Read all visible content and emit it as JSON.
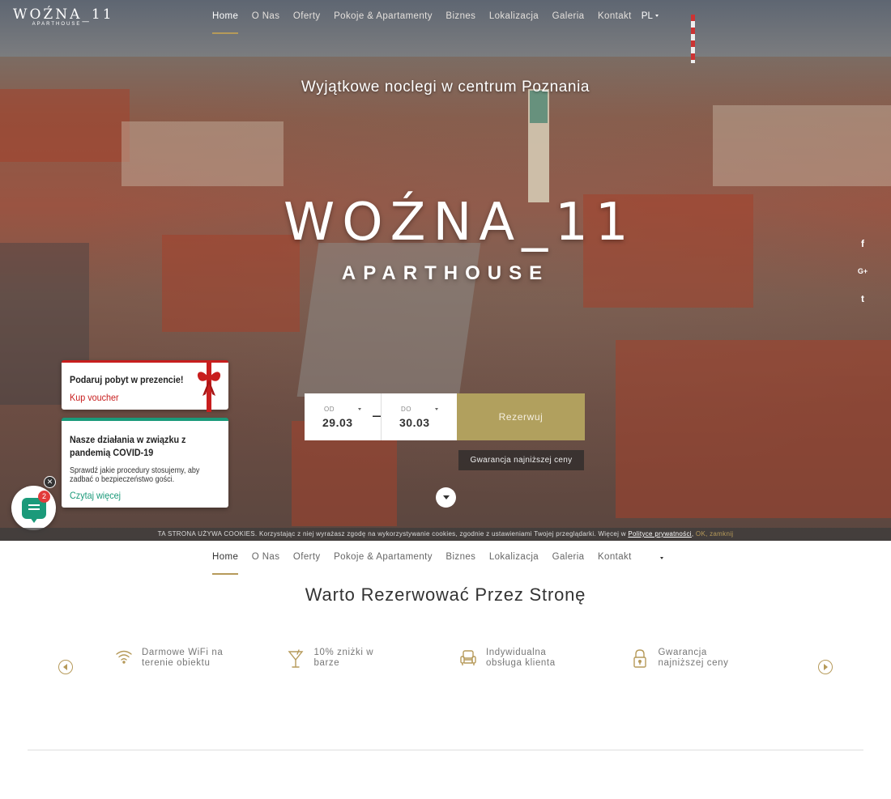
{
  "brand": {
    "name": "WOŹNA_11",
    "sub": "APARTHOUSE"
  },
  "nav": {
    "items": [
      "Home",
      "O Nas",
      "Oferty",
      "Pokoje & Apartamenty",
      "Biznes",
      "Lokalizacja",
      "Galeria",
      "Kontakt"
    ],
    "active": "Home",
    "lang": "PL"
  },
  "hero": {
    "tagline": "Wyjątkowe noclegi w centrum Poznania",
    "logo_word": "WOŹNA_11",
    "logo_sub": "APARTHOUSE"
  },
  "social": [
    "facebook-icon",
    "google-plus-icon",
    "twitter-icon"
  ],
  "social_glyphs": [
    "f",
    "G+",
    "t"
  ],
  "booking": {
    "from_label": "OD",
    "from_value": "29.03",
    "to_label": "DO",
    "to_value": "30.03",
    "reserve_label": "Rezerwuj",
    "guarantee": "Gwarancja najniższej ceny"
  },
  "voucher_popup": {
    "title": "Podaruj pobyt w prezencie!",
    "link": "Kup voucher"
  },
  "covid_popup": {
    "title": "Nasze działania w związku z pandemią COVID-19",
    "desc": "Sprawdź jakie procedury stosujemy, aby zadbać o bezpieczeństwo gości.",
    "link": "Czytaj więcej"
  },
  "chat": {
    "badge": "2"
  },
  "cookie": {
    "text": "TA STRONA UŻYWA COOKIES. Korzystając z niej wyrażasz zgodę na wykorzystywanie cookies, zgodnie z ustawieniami Twojej przeglądarki. Więcej w",
    "policy": "Polityce prywatności",
    "ok": "OK, zamknij"
  },
  "section": {
    "title": "Warto Rezerwować Przez Stronę",
    "features": [
      {
        "icon": "wifi-icon",
        "text": "Darmowe WiFi na terenie obiektu"
      },
      {
        "icon": "cocktail-icon",
        "text": "10% zniżki w barze"
      },
      {
        "icon": "armchair-icon",
        "text": "Indywidualna obsługa klienta"
      },
      {
        "icon": "lock-icon",
        "text": "Gwarancja najniższej ceny"
      }
    ]
  },
  "colors": {
    "accent": "#b69a5a",
    "reserve": "#b1a05e",
    "covid": "#1b9a7a",
    "voucher": "#c81e1e"
  }
}
